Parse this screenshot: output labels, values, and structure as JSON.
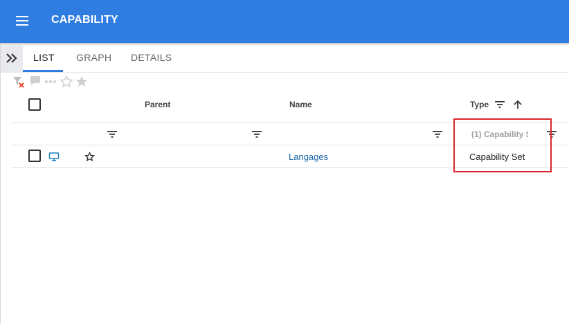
{
  "app": {
    "title": "CAPABILITY"
  },
  "icons": {
    "menu": "hamburger-menu-icon",
    "expand": "double-chevron-right-icon",
    "filter_clear": "filter-clear-icon",
    "comment": "comment-icon",
    "more": "more-horizontal-icon",
    "star_outline": "star-outline-icon",
    "star_filled": "star-filled-icon",
    "sort_asc": "arrow-up-icon",
    "filter": "filter-lines-icon",
    "monitor": "monitor-icon"
  },
  "colors": {
    "appbar": "#2f7de1",
    "link": "#1a66a8",
    "highlight": "#d9262c"
  },
  "tabs": [
    {
      "label": "LIST",
      "active": true
    },
    {
      "label": "GRAPH",
      "active": false
    },
    {
      "label": "DETAILS",
      "active": false
    }
  ],
  "table": {
    "columns": [
      {
        "label": "Parent"
      },
      {
        "label": "Name"
      },
      {
        "label": "Type",
        "sorted": "ascending"
      }
    ],
    "filters": {
      "type_value": "(1) Capability S"
    },
    "rows": [
      {
        "parent": "",
        "name": "Langages",
        "type": "Capability Set",
        "favorite": false
      }
    ]
  }
}
